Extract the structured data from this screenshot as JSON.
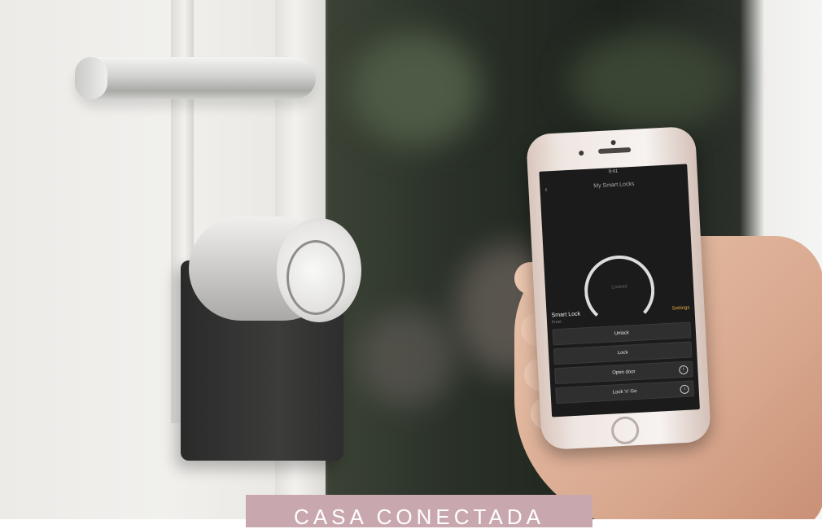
{
  "photo": {
    "description_icon": "smart-lock-photo-icon"
  },
  "phone": {
    "status_time": "9:41",
    "app_title": "My Smart Locks",
    "back_symbol": "‹",
    "gauge_label": "Locked",
    "lock_name": "Smart Lock",
    "lock_subtitle": "Front",
    "settings_label": "Settings",
    "buttons": [
      {
        "label": "Unlock",
        "info": ""
      },
      {
        "label": "Lock",
        "info": ""
      },
      {
        "label": "Open door",
        "info": "i"
      },
      {
        "label": "Lock 'n' Go",
        "info": "i"
      }
    ]
  },
  "banner": {
    "text": "CASA CONECTADA",
    "color": "#c8a8ae"
  }
}
